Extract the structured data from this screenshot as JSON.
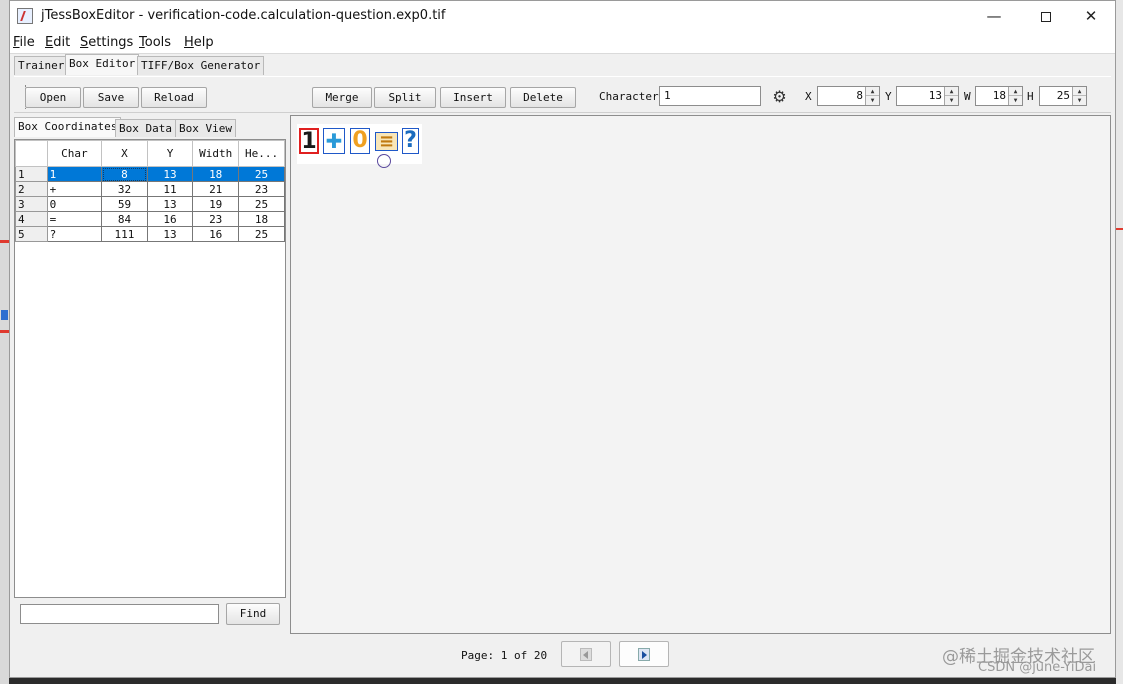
{
  "window": {
    "title": "jTessBoxEditor - verification-code.calculation-question.exp0.tif"
  },
  "menu": [
    "File",
    "Edit",
    "Settings",
    "Tools",
    "Help"
  ],
  "tabs": [
    "Trainer",
    "Box Editor",
    "TIFF/Box Generator"
  ],
  "toolbar": {
    "open": "Open",
    "save": "Save",
    "reload": "Reload",
    "merge": "Merge",
    "split": "Split",
    "insert": "Insert",
    "delete": "Delete",
    "character_label": "Character",
    "character_value": "1",
    "x_label": "X",
    "x_value": "8",
    "y_label": "Y",
    "y_value": "13",
    "w_label": "W",
    "w_value": "18",
    "h_label": "H",
    "h_value": "25"
  },
  "subtabs": [
    "Box Coordinates",
    "Box Data",
    "Box View"
  ],
  "table": {
    "headers": [
      "Char",
      "X",
      "Y",
      "Width",
      "He..."
    ],
    "rows": [
      {
        "n": "1",
        "char": "1",
        "x": "8",
        "y": "13",
        "w": "18",
        "h": "25"
      },
      {
        "n": "2",
        "char": "+",
        "x": "32",
        "y": "11",
        "w": "21",
        "h": "23"
      },
      {
        "n": "3",
        "char": "0",
        "x": "59",
        "y": "13",
        "w": "19",
        "h": "25"
      },
      {
        "n": "4",
        "char": "=",
        "x": "84",
        "y": "16",
        "w": "23",
        "h": "18"
      },
      {
        "n": "5",
        "char": "?",
        "x": "111",
        "y": "13",
        "w": "16",
        "h": "25"
      }
    ],
    "selected_row": 0
  },
  "find": {
    "button": "Find",
    "value": ""
  },
  "image_glyphs": [
    "1",
    "✚",
    "0",
    "≡",
    "?"
  ],
  "footer": {
    "page_label": "Page:",
    "page_current": "1",
    "page_of": "of",
    "page_total": "20"
  },
  "watermark": {
    "line1": "@稀土掘金技术社区",
    "line2": "CSDN @june-YiDai"
  },
  "colors": {
    "selection": "#0078d7",
    "box_selected": "#e02020",
    "box_normal": "#1f58c8"
  }
}
